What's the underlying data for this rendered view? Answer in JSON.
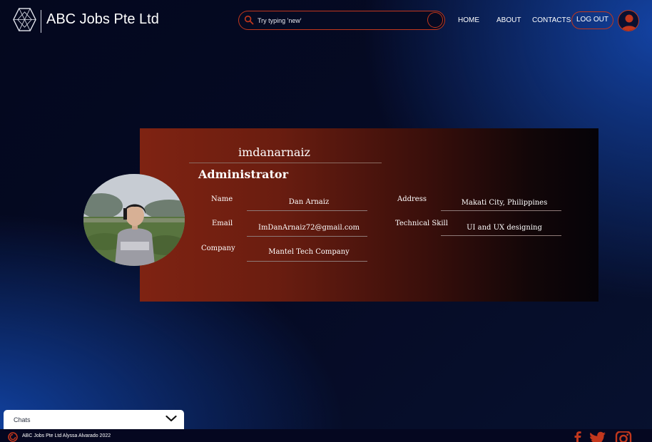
{
  "header": {
    "brand": "ABC Jobs Pte Ltd",
    "search_placeholder": "Try typing 'new'",
    "nav": [
      "HOME",
      "ABOUT",
      "CONTACTS"
    ],
    "logout_label": "LOG OUT",
    "accent_color": "#c2371d"
  },
  "profile": {
    "username": "imdanarnaiz",
    "role": "Administrator",
    "fields": {
      "name": {
        "label": "Name",
        "value": "Dan Arnaiz"
      },
      "email": {
        "label": "Email",
        "value": "ImDanArnaiz72@gmail.com"
      },
      "company": {
        "label": "Company",
        "value": "Mantel Tech Company"
      },
      "address": {
        "label": "Address",
        "value": "Makati City, Philippines"
      },
      "skill": {
        "label": "Technical Skill",
        "value": "UI and UX designing"
      }
    }
  },
  "chats": {
    "label": "Chats"
  },
  "footer": {
    "text": "ABC Jobs Pte Ltd Alyssa Alvarado 2022",
    "social": [
      "facebook-icon",
      "twitter-icon",
      "instagram-icon"
    ]
  }
}
